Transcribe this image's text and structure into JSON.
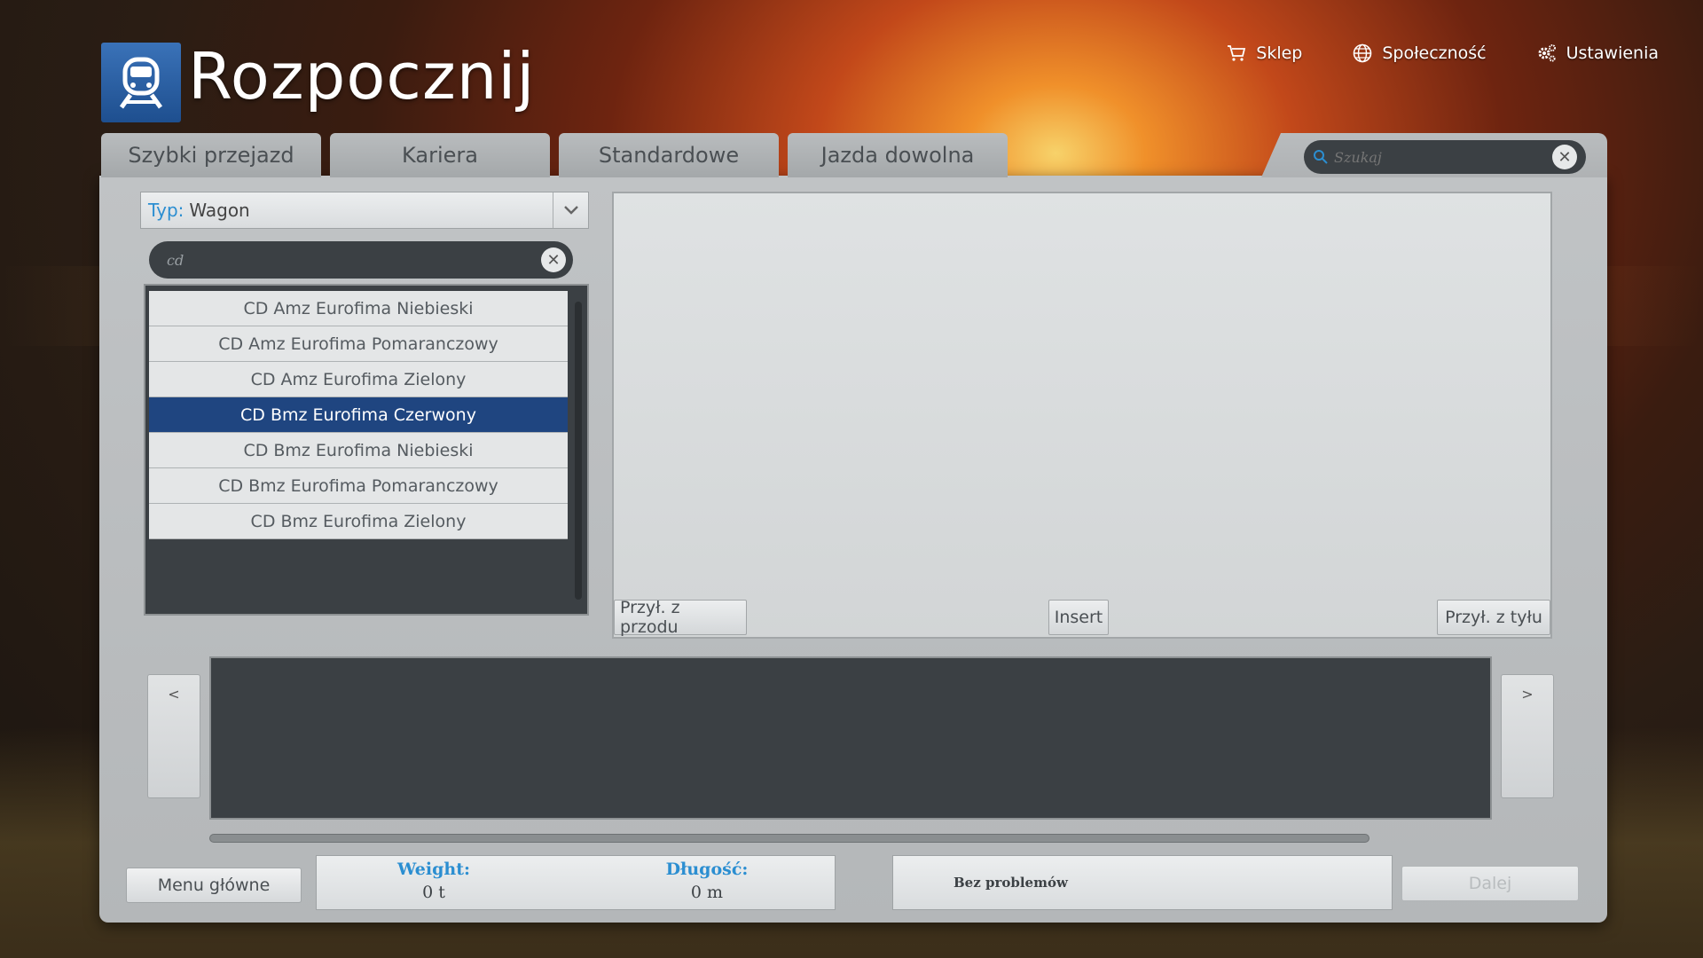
{
  "header": {
    "title": "Rozpocznij",
    "nav": [
      {
        "label": "Sklep",
        "icon": "cart-icon"
      },
      {
        "label": "Społeczność",
        "icon": "globe-icon"
      },
      {
        "label": "Ustawienia",
        "icon": "gears-icon"
      }
    ]
  },
  "tabs": [
    "Szybki przejazd",
    "Kariera",
    "Standardowe",
    "Jazda dowolna"
  ],
  "search": {
    "placeholder": "Szukaj"
  },
  "filter": {
    "type_label": "Typ:",
    "type_value": "Wagon",
    "query": "cd"
  },
  "list": {
    "items": [
      "CD Amz Eurofima Niebieski",
      "CD Amz Eurofima Pomaranczowy",
      "CD Amz Eurofima Zielony",
      "CD Bmz Eurofima Czerwony",
      "CD Bmz Eurofima Niebieski",
      "CD Bmz Eurofima Pomaranczowy",
      "CD Bmz Eurofima Zielony"
    ],
    "selected": "CD Bmz Eurofima Czerwony"
  },
  "preview": {
    "front_label": "Przył. z przodu",
    "insert_label": "Insert",
    "back_label": "Przył. z tyłu"
  },
  "consist": {
    "prev_label": "<",
    "next_label": ">"
  },
  "footer": {
    "menu_label": "Menu główne",
    "weight_label": "Weight:",
    "weight_value": "0 t",
    "length_label": "Długość:",
    "length_value": "0 m",
    "status": "Bez problemów",
    "next_label": "Dalej"
  },
  "colors": {
    "accent": "#2b8ed1",
    "selected": "#1f4580",
    "logo": "#2b62a8"
  }
}
